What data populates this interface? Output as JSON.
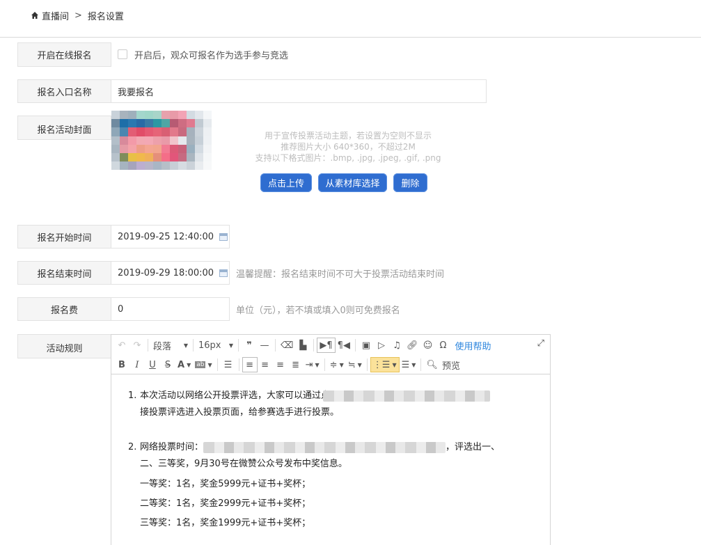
{
  "breadcrumb": {
    "home": "直播间",
    "separator": ">",
    "current": "报名设置"
  },
  "form": {
    "online_signup": {
      "label": "开启在线报名",
      "hint": "开启后，观众可报名作为选手参与竞选"
    },
    "entry_name": {
      "label": "报名入口名称",
      "value": "我要报名"
    },
    "cover": {
      "label": "报名活动封面",
      "hint_lines": [
        "用于宣传投票活动主题，若设置为空则不显示",
        "推荐图片大小 640*360，不超过2M",
        "支持以下格式图片：.bmp, .jpg, .jpeg, .gif, .png"
      ],
      "upload_label": "点击上传",
      "library_label": "从素材库选择",
      "delete_label": "删除"
    },
    "start_time": {
      "label": "报名开始时间",
      "value": "2019-09-25 12:40:00"
    },
    "end_time": {
      "label": "报名结束时间",
      "value": "2019-09-29 18:00:00",
      "hint": "温馨提醒：报名结束时间不可大于投票活动结束时间"
    },
    "fee": {
      "label": "报名费",
      "value": "0",
      "hint": "单位（元），若不填或填入0则可免费报名"
    },
    "rules": {
      "label": "活动规则"
    }
  },
  "editor": {
    "paragraph_label": "段落",
    "font_size_label": "16px",
    "help_label": "使用帮助",
    "preview_label": "预览",
    "content": {
      "p1_num": "1.",
      "p1_a": "本次活动以网络公开投票评选，大家可以通过点",
      "p1_b": "接投票评选进入投票页面，给参赛选手进行投票。",
      "p2_num": "2.",
      "p2_a": "网络投票时间：",
      "p2_a_end": "，评选出一、",
      "p2_b": "二、三等奖，9月30号在微赞公众号发布中奖信息。",
      "prize1": "一等奖：1名，奖金5999元+证书+奖杯；",
      "prize2": "二等奖：1名，奖金2999元+证书+奖杯；",
      "prize3": "三等奖：1名，奖金1999元+证书+奖杯；"
    }
  },
  "colors": {
    "primary_button": "#2f6dd0",
    "link": "#2e86de",
    "label_bg": "#f5f5f5",
    "hint": "#999999",
    "active_tool": "#fbe29a"
  },
  "cover_mosaic_colors": [
    "#c9d2da",
    "#a8b3bd",
    "#9fb0bc",
    "#a3d6cc",
    "#9fd6c8",
    "#a8d5c9",
    "#e7a1ac",
    "#e89aa8",
    "#f3a3b5",
    "#d3dbe2",
    "#e2e7ec",
    "#f4f6f8",
    "#6f8aa0",
    "#1d6ea8",
    "#2b78b0",
    "#2a6aa6",
    "#3b7aa6",
    "#2c98a3",
    "#4ea6a5",
    "#b75b73",
    "#ce6d82",
    "#e07a8f",
    "#c1cad2",
    "#e6eaee",
    "#8fa7b8",
    "#4b86b0",
    "#e35d74",
    "#e14d68",
    "#e55a73",
    "#e66478",
    "#d95f73",
    "#e2798b",
    "#c96a7f",
    "#a6b2bd",
    "#ccd4db",
    "#edf0f3",
    "#b3bfc9",
    "#d88a9b",
    "#f39aa8",
    "#f2a9b2",
    "#f3a8b4",
    "#eda0ab",
    "#e99aa8",
    "#f1c4cb",
    "#e5e9ed",
    "#a7b3bd",
    "#c7d0d8",
    "#eef1f4",
    "#a9b6c1",
    "#e59ba6",
    "#f4a3a9",
    "#ee9d88",
    "#f4a592",
    "#f2a58e",
    "#f27b93",
    "#dc5a77",
    "#c7627a",
    "#9ab0bf",
    "#d3dbe2",
    "#f2f4f6",
    "#b7c2cb",
    "#7f8d5b",
    "#e8c046",
    "#f0b94c",
    "#f0b05a",
    "#e58f7a",
    "#f46e88",
    "#e2567a",
    "#c66b81",
    "#aab6c0",
    "#dfe4e9",
    "#f5f7f8",
    "#d0d8de",
    "#a6b4c0",
    "#a6a4bc",
    "#bcaed0",
    "#b8b5c9",
    "#a9b6c5",
    "#b6bfc8",
    "#c7ced6",
    "#d6dce2",
    "#cbd2d9",
    "#e9ecef",
    "#f7f8f9"
  ]
}
